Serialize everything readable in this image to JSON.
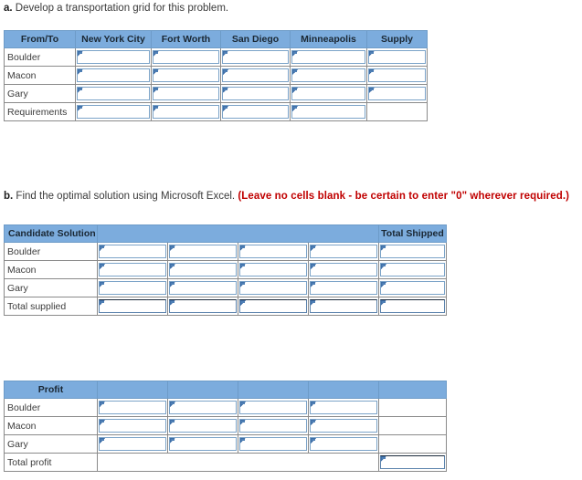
{
  "questions": {
    "a": {
      "label": "a.",
      "text": " Develop a transportation grid for this problem."
    },
    "b": {
      "label": "b.",
      "text": " Find the optimal solution using Microsoft Excel. ",
      "note": "(Leave no cells blank - be certain to enter \"0\" wherever required.)"
    }
  },
  "colors": {
    "header_blue": "#7cacdd",
    "note_red": "#c00000",
    "cell_border": "#7ba3c8",
    "grid_line": "#8a8a8a"
  },
  "transportation_grid": {
    "headers": [
      "From/To",
      "New York City",
      "Fort Worth",
      "San Diego",
      "Minneapolis",
      "Supply"
    ],
    "rows": [
      {
        "label": "Boulder",
        "inputs": [
          true,
          true,
          true,
          true,
          true
        ]
      },
      {
        "label": "Macon",
        "inputs": [
          true,
          true,
          true,
          true,
          true
        ]
      },
      {
        "label": "Gary",
        "inputs": [
          true,
          true,
          true,
          true,
          true
        ]
      },
      {
        "label": "Requirements",
        "inputs": [
          true,
          true,
          true,
          true,
          false
        ]
      }
    ]
  },
  "candidate_solution": {
    "headers": [
      "Candidate Solution",
      "",
      "Total Shipped"
    ],
    "rows": [
      {
        "label": "Boulder",
        "inputs": [
          true,
          true,
          true,
          true,
          true
        ]
      },
      {
        "label": "Macon",
        "inputs": [
          true,
          true,
          true,
          true,
          true
        ]
      },
      {
        "label": "Gary",
        "inputs": [
          true,
          true,
          true,
          true,
          true
        ]
      },
      {
        "label": "Total supplied",
        "inputs": [
          true,
          true,
          true,
          true,
          true
        ]
      }
    ]
  },
  "profit_table": {
    "headers": [
      "Profit",
      "",
      "",
      "",
      "",
      ""
    ],
    "rows": [
      {
        "label": "Boulder",
        "inputs": [
          true,
          true,
          true,
          true,
          false
        ]
      },
      {
        "label": "Macon",
        "inputs": [
          true,
          true,
          true,
          true,
          false
        ]
      },
      {
        "label": "Gary",
        "inputs": [
          true,
          true,
          true,
          true,
          false
        ]
      },
      {
        "label": "Total profit",
        "inputs": [
          false,
          false,
          false,
          false,
          true
        ]
      }
    ]
  }
}
